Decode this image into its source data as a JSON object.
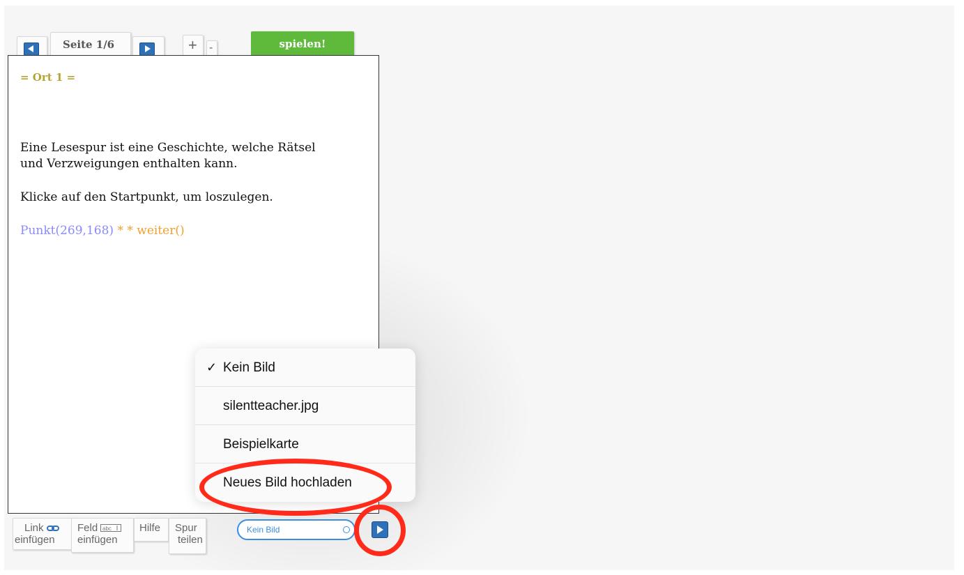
{
  "toolbar": {
    "page_label": "Seite 1/6",
    "zoom_in": "+",
    "zoom_out": "-",
    "play_label": "spielen!"
  },
  "editor": {
    "heading": "= Ort 1 =",
    "paragraph1_line1": "Eine Lesespur ist eine Geschichte, welche Rätsel",
    "paragraph1_line2": "und Verzweigungen enthalten kann.",
    "paragraph2": "Klicke auf den Startpunkt, um loszulegen.",
    "code_point": "Punkt(269,168)",
    "code_op": " * * ",
    "code_call": "weiter()"
  },
  "image_menu": {
    "items": [
      {
        "label": "Kein Bild",
        "checked": true
      },
      {
        "label": "silentteacher.jpg",
        "checked": false
      },
      {
        "label": "Beispielkarte",
        "checked": false
      },
      {
        "label": "Neues Bild hochladen",
        "checked": false
      }
    ],
    "check_mark": "✓"
  },
  "bottom_tools": {
    "link_line1": "Link",
    "link_line2": "einfügen",
    "field_line1": "Feld",
    "field_line2": "einfügen",
    "help": "Hilfe",
    "share_line1": "Spur",
    "share_line2": "teilen"
  },
  "image_select": {
    "value": "Kein Bild"
  },
  "colors": {
    "heading": "#b4a535",
    "code_point": "#8a8aff",
    "code_call": "#f0a030",
    "play_button": "#5fba3c",
    "nav_button": "#2f71b9",
    "annotation": "#ff2a1a"
  },
  "icons": {
    "prev": "triangle-left-icon",
    "next": "triangle-right-icon",
    "link": "chain-link-icon",
    "field": "text-field-icon",
    "go": "triangle-right-icon"
  }
}
